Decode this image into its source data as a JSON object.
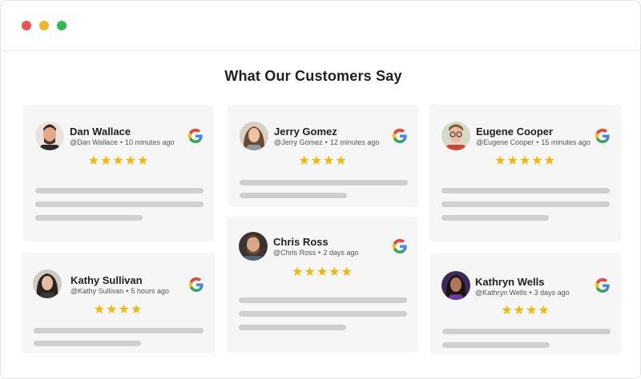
{
  "page": {
    "heading": "What Our Customers Say"
  },
  "colors": {
    "star": "#f6b700",
    "card_bg": "#f6f6f6",
    "placeholder_line": "#cfcfcf"
  },
  "reviews": [
    {
      "name": "Dan Wallace",
      "handle": "@Dan Wallace",
      "time": "10 minutes ago",
      "stars": "★★★★★",
      "rating": 5,
      "source_icon": "google-icon"
    },
    {
      "name": "Jerry Gomez",
      "handle": "@Jerry Gomez",
      "time": "12 minutes ago",
      "stars": "★★★★",
      "rating": 4,
      "source_icon": "google-icon"
    },
    {
      "name": "Eugene Cooper",
      "handle": "@Eugene Cooper",
      "time": "15 minutes ago",
      "stars": "★★★★★",
      "rating": 5,
      "source_icon": "google-icon"
    },
    {
      "name": "Chris Ross",
      "handle": "@Chris Ross",
      "time": "2 days ago",
      "stars": "★★★★★",
      "rating": 5,
      "source_icon": "google-icon"
    },
    {
      "name": "Kathy Sullivan",
      "handle": "@Kathy Sullivan",
      "time": "5 hours ago",
      "stars": "★★★★",
      "rating": 4,
      "source_icon": "google-icon"
    },
    {
      "name": "Kathryn Wells",
      "handle": "@Kathryn Wells",
      "time": "3 days ago",
      "stars": "★★★★",
      "rating": 4,
      "source_icon": "google-icon"
    }
  ]
}
